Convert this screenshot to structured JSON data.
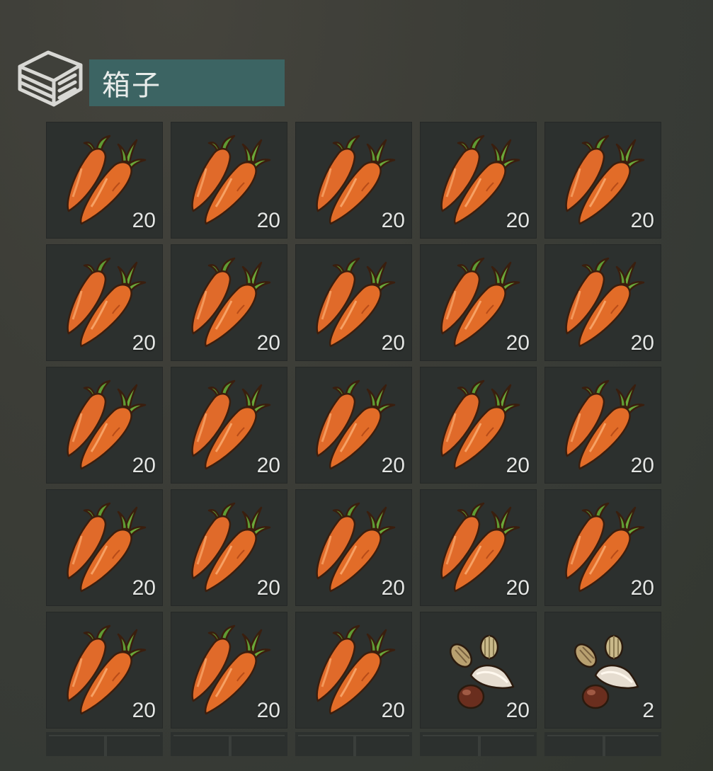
{
  "container": {
    "title": "箱子",
    "icon": "chest-icon"
  },
  "slots": [
    {
      "item": "carrot",
      "icon": "carrot-icon",
      "count": "20"
    },
    {
      "item": "carrot",
      "icon": "carrot-icon",
      "count": "20"
    },
    {
      "item": "carrot",
      "icon": "carrot-icon",
      "count": "20"
    },
    {
      "item": "carrot",
      "icon": "carrot-icon",
      "count": "20"
    },
    {
      "item": "carrot",
      "icon": "carrot-icon",
      "count": "20"
    },
    {
      "item": "carrot",
      "icon": "carrot-icon",
      "count": "20"
    },
    {
      "item": "carrot",
      "icon": "carrot-icon",
      "count": "20"
    },
    {
      "item": "carrot",
      "icon": "carrot-icon",
      "count": "20"
    },
    {
      "item": "carrot",
      "icon": "carrot-icon",
      "count": "20"
    },
    {
      "item": "carrot",
      "icon": "carrot-icon",
      "count": "20"
    },
    {
      "item": "carrot",
      "icon": "carrot-icon",
      "count": "20"
    },
    {
      "item": "carrot",
      "icon": "carrot-icon",
      "count": "20"
    },
    {
      "item": "carrot",
      "icon": "carrot-icon",
      "count": "20"
    },
    {
      "item": "carrot",
      "icon": "carrot-icon",
      "count": "20"
    },
    {
      "item": "carrot",
      "icon": "carrot-icon",
      "count": "20"
    },
    {
      "item": "carrot",
      "icon": "carrot-icon",
      "count": "20"
    },
    {
      "item": "carrot",
      "icon": "carrot-icon",
      "count": "20"
    },
    {
      "item": "carrot",
      "icon": "carrot-icon",
      "count": "20"
    },
    {
      "item": "carrot",
      "icon": "carrot-icon",
      "count": "20"
    },
    {
      "item": "carrot",
      "icon": "carrot-icon",
      "count": "20"
    },
    {
      "item": "carrot",
      "icon": "carrot-icon",
      "count": "20"
    },
    {
      "item": "carrot",
      "icon": "carrot-icon",
      "count": "20"
    },
    {
      "item": "carrot",
      "icon": "carrot-icon",
      "count": "20"
    },
    {
      "item": "seeds",
      "icon": "seeds-icon",
      "count": "20"
    },
    {
      "item": "seeds",
      "icon": "seeds-icon",
      "count": "2"
    }
  ],
  "colors": {
    "title_bg": "#3c6463",
    "slot_bg": "#2c302e",
    "carrot": "#e06a2a",
    "leaf": "#6aa83a"
  }
}
